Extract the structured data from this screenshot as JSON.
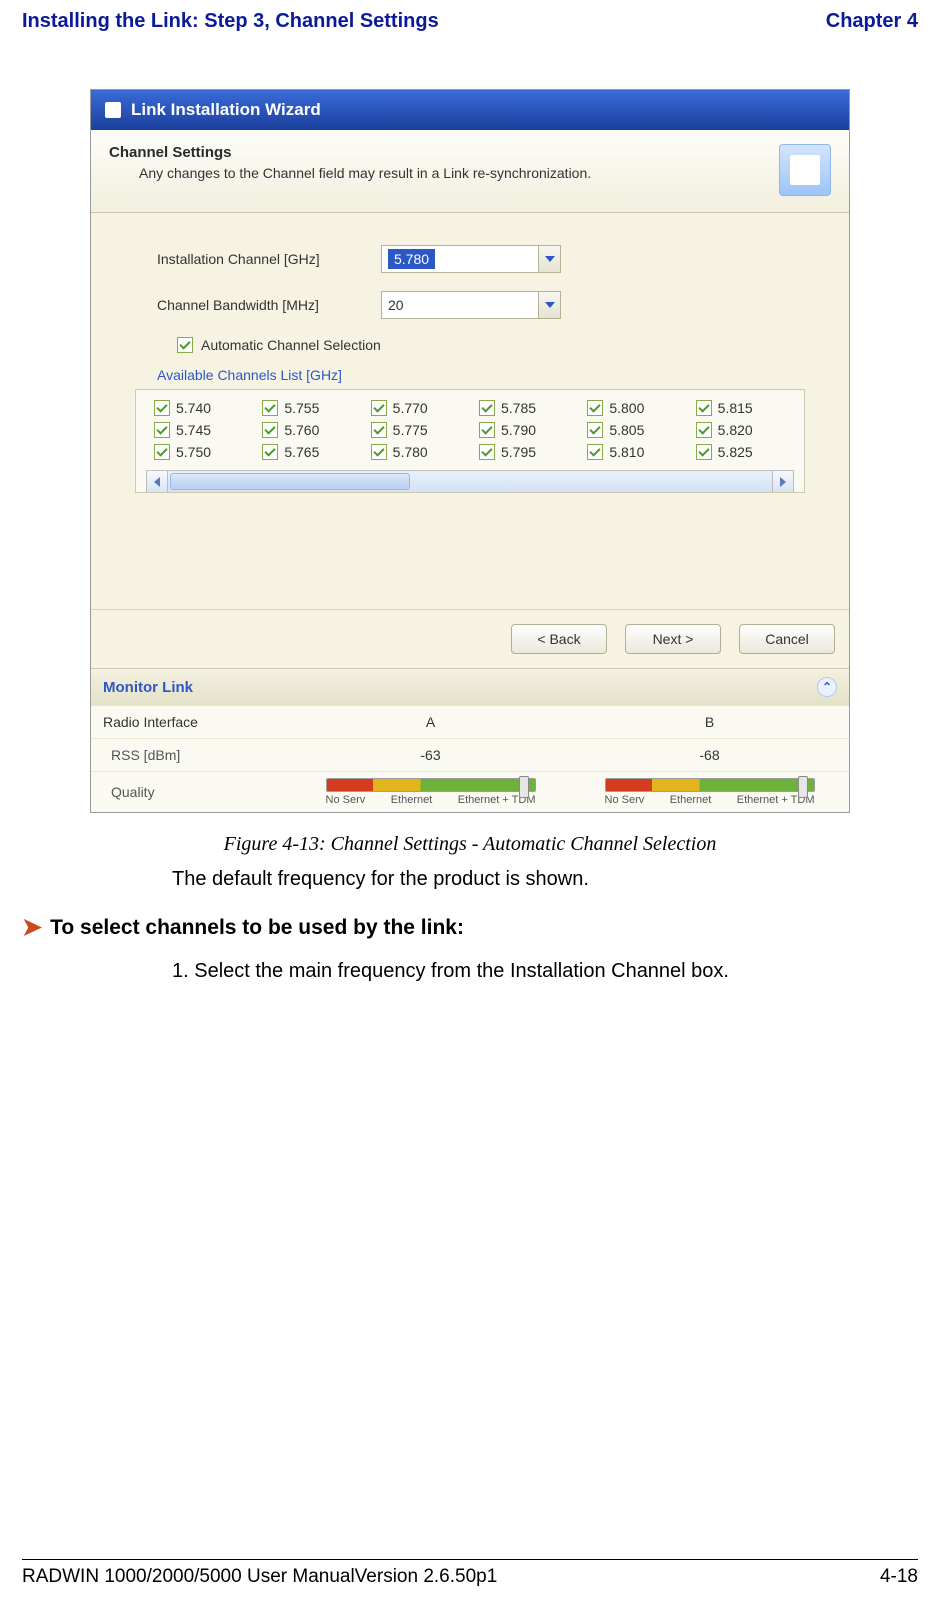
{
  "header": {
    "title": "Installing the Link: Step 3, Channel Settings",
    "chapter": "Chapter 4"
  },
  "wizard": {
    "title": "Link Installation Wizard",
    "section_title": "Channel Settings",
    "section_sub": "Any changes to the Channel field may result in a Link re-synchronization.",
    "install_channel_label": "Installation Channel [GHz]",
    "install_channel_value": "5.780",
    "bandwidth_label": "Channel Bandwidth [MHz]",
    "bandwidth_value": "20",
    "acs_label": "Automatic Channel Selection",
    "available_label": "Available Channels List [GHz]",
    "channels": [
      "5.740",
      "5.755",
      "5.770",
      "5.785",
      "5.800",
      "5.815",
      "5.745",
      "5.760",
      "5.775",
      "5.790",
      "5.805",
      "5.820",
      "5.750",
      "5.765",
      "5.780",
      "5.795",
      "5.810",
      "5.825"
    ],
    "buttons": {
      "back": "< Back",
      "next": "Next >",
      "cancel": "Cancel"
    },
    "monitor": {
      "title": "Monitor Link",
      "radio_interface": "Radio Interface",
      "col_a": "A",
      "col_b": "B",
      "rss_label": "RSS [dBm]",
      "quality_label": "Quality",
      "rss_a": "-63",
      "rss_b": "-68",
      "q1": "No Serv",
      "q2": "Ethernet",
      "q3": "Ethernet + TDM"
    }
  },
  "caption": "Figure 4-13: Channel Settings - Automatic Channel Selection",
  "para1": "The default frequency for the product is shown.",
  "procedure_heading": "To select channels to be used by the link:",
  "step1": "1. Select the main frequency from the Installation Channel box.",
  "footer": {
    "left": "RADWIN 1000/2000/5000 User ManualVersion  2.6.50p1",
    "right": "4-18"
  }
}
